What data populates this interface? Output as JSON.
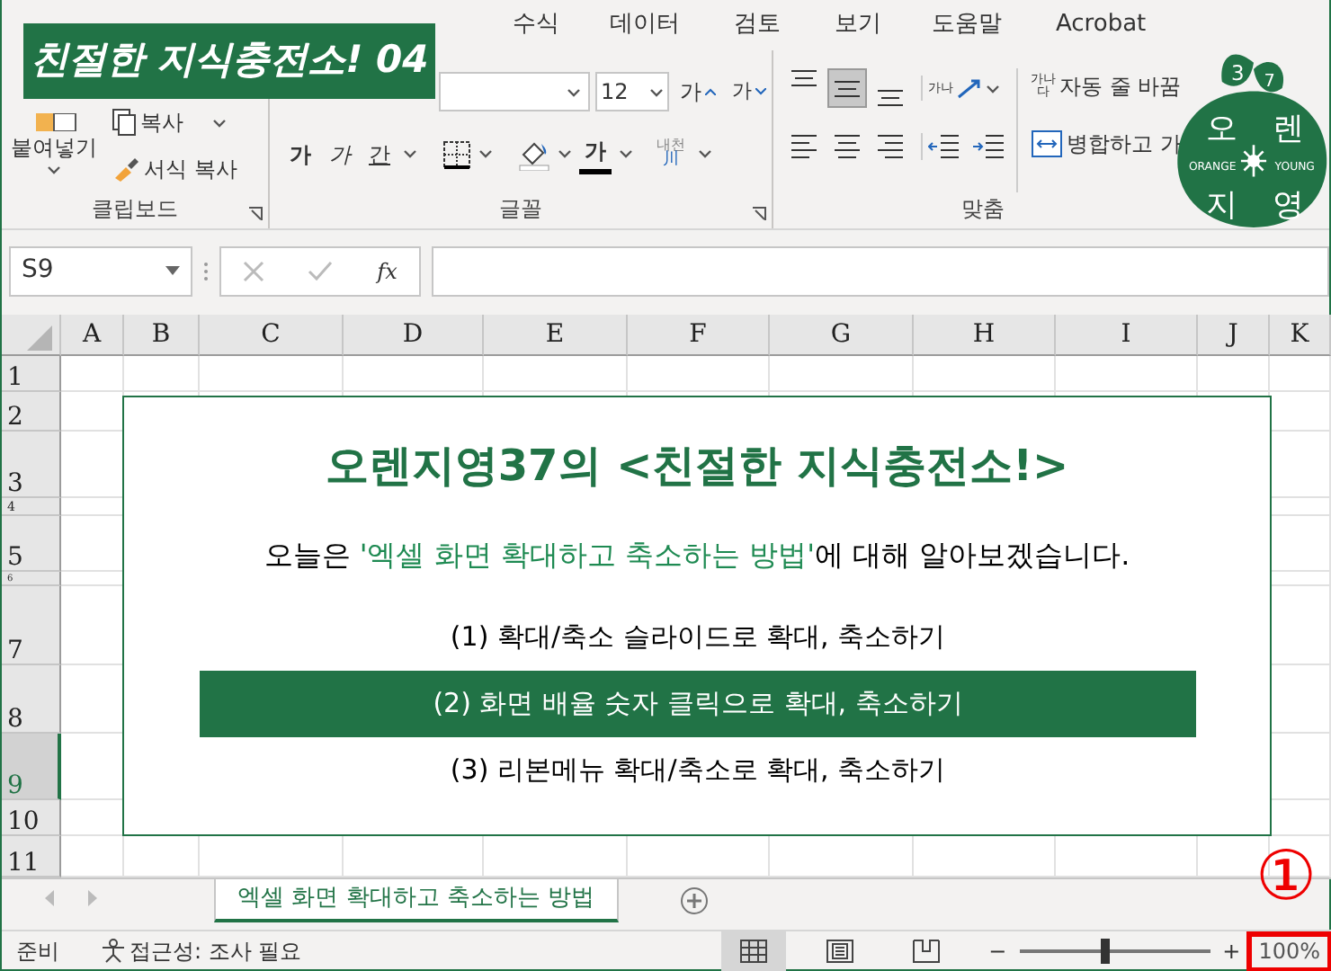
{
  "menu_tabs": [
    "수식",
    "데이터",
    "검토",
    "보기",
    "도움말",
    "Acrobat"
  ],
  "banner": "친절한 지식충전소! 04",
  "ribbon": {
    "clipboard": {
      "paste": "붙여넣기",
      "copy": "복사",
      "format_painter": "서식 복사",
      "label": "클립보드"
    },
    "font": {
      "size": "12",
      "grow": "가",
      "shrink": "가",
      "bold": "가",
      "italic": "가",
      "underline": "간",
      "font_color": "가",
      "phonetic": "내천",
      "phonetic_glyph": "川",
      "label": "글꼴"
    },
    "alignment": {
      "vertical": [
        {
          "selected": false
        },
        {
          "selected": true
        },
        {
          "selected": false
        }
      ],
      "orientation_glyph": "가나",
      "wrap_glyph": "가나다",
      "wrap": "자동 줄 바꿈",
      "merge": "병합하고 가",
      "label": "맞춤"
    }
  },
  "logo": {
    "digits": [
      "3",
      "7"
    ],
    "syllables": [
      "오",
      "렌",
      "지",
      "영"
    ],
    "left_word": "ORANGE",
    "right_word": "YOUNG"
  },
  "formula_bar": {
    "name_box": "S9",
    "fx": "fx"
  },
  "columns": [
    "A",
    "B",
    "C",
    "D",
    "E",
    "F",
    "G",
    "H",
    "I",
    "J",
    "K"
  ],
  "rows": [
    {
      "label": "1",
      "selected": false
    },
    {
      "label": "2",
      "selected": false
    },
    {
      "label": "3",
      "selected": false
    },
    {
      "label": "4",
      "selected": false
    },
    {
      "label": "5",
      "selected": false
    },
    {
      "label": "6",
      "selected": false
    },
    {
      "label": "7",
      "selected": false
    },
    {
      "label": "8",
      "selected": false
    },
    {
      "label": "9",
      "selected": true
    },
    {
      "label": "10",
      "selected": false
    },
    {
      "label": "11",
      "selected": false
    }
  ],
  "content": {
    "title": "오렌지영37의 <친절한 지식충전소!>",
    "intro": {
      "before": "오늘은 ",
      "highlight": "'엑셀 화면 확대하고 축소하는 방법'",
      "after": "에 대해 알아보겠습니다."
    },
    "items": [
      {
        "text": "(1) 확대/축소 슬라이드로 확대, 축소하기",
        "highlighted": false
      },
      {
        "text": "(2) 화면 배율 숫자 클릭으로 확대, 축소하기",
        "highlighted": true
      },
      {
        "text": "(3) 리본메뉴 확대/축소로 확대, 축소하기",
        "highlighted": false
      }
    ]
  },
  "sheet_tabs": [
    {
      "label": "엑셀 화면 확대하고 축소하는 방법",
      "selected": true
    }
  ],
  "status_bar": {
    "ready": "준비",
    "accessibility": "접근성: 조사 필요",
    "views": [
      {
        "kind": "normal",
        "selected": true
      },
      {
        "kind": "page-layout",
        "selected": false
      },
      {
        "kind": "page-break",
        "selected": false
      }
    ],
    "minus": "−",
    "plus": "+",
    "zoom": {
      "level": 0.45
    },
    "zoom_percent": "100%"
  },
  "annotation": {
    "marker": "①"
  }
}
